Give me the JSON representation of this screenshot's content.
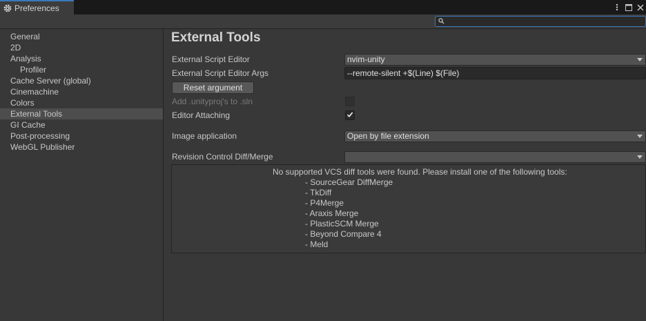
{
  "window": {
    "tab_title": "Preferences",
    "tab_icon": "gear-icon",
    "controls": [
      "more-icon",
      "maximize-icon",
      "close-icon"
    ]
  },
  "search": {
    "placeholder": "",
    "value": ""
  },
  "sidebar": {
    "items": [
      {
        "label": "General"
      },
      {
        "label": "2D"
      },
      {
        "label": "Analysis"
      },
      {
        "label": "Profiler"
      },
      {
        "label": "Cache Server (global)"
      },
      {
        "label": "Cinemachine"
      },
      {
        "label": "Colors"
      },
      {
        "label": "External Tools",
        "selected": true
      },
      {
        "label": "GI Cache"
      },
      {
        "label": "Post-processing"
      },
      {
        "label": "WebGL Publisher"
      }
    ]
  },
  "main": {
    "title": "External Tools",
    "script_editor": {
      "label": "External Script Editor",
      "value": "nvim-unity"
    },
    "script_editor_args": {
      "label": "External Script Editor Args",
      "value": "--remote-silent +$(Line) $(File)"
    },
    "reset_button": "Reset argument",
    "add_unityproj": {
      "label": "Add .unityproj's to .sln",
      "checked": false,
      "disabled": true
    },
    "editor_attaching": {
      "label": "Editor Attaching",
      "checked": true
    },
    "image_application": {
      "label": "Image application",
      "value": "Open by file extension"
    },
    "revision_control": {
      "label": "Revision Control Diff/Merge",
      "value": ""
    },
    "help": {
      "message": "No supported VCS diff tools were found. Please install one of the following tools:",
      "tools": [
        "- SourceGear DiffMerge",
        "- TkDiff",
        "- P4Merge",
        "- Araxis Merge",
        "- PlasticSCM Merge",
        "- Beyond Compare 4",
        "- Meld"
      ]
    }
  },
  "colors": {
    "accent": "#3a79bb",
    "background": "#383838",
    "selected_item": "#4d4d4d"
  }
}
